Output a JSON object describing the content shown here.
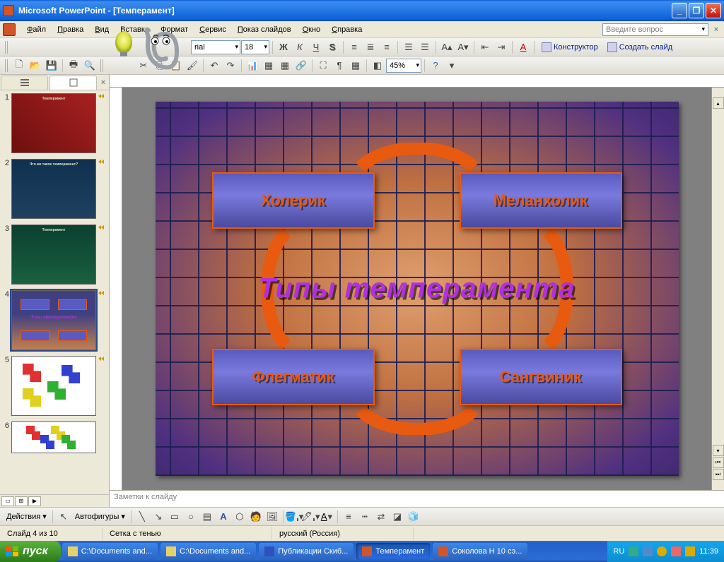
{
  "window": {
    "title": "Microsoft PowerPoint - [Темперамент]"
  },
  "menu": {
    "items": [
      "Файл",
      "Правка",
      "Вид",
      "Вставка",
      "Формат",
      "Сервис",
      "Показ слайдов",
      "Окно",
      "Справка"
    ],
    "help_placeholder": "Введите вопрос"
  },
  "toolbar1": {
    "font": "rial",
    "size": "18",
    "constructor": "Конструктор",
    "newslide": "Создать слайд"
  },
  "toolbar2": {
    "zoom": "45%"
  },
  "slide": {
    "title": "Типы темперамента",
    "box_tl": "Холерик",
    "box_tr": "Меланхолик",
    "box_bl": "Флегматик",
    "box_br": "Сангвиник"
  },
  "thumbs": [
    {
      "n": "1"
    },
    {
      "n": "2"
    },
    {
      "n": "3"
    },
    {
      "n": "4"
    },
    {
      "n": "5"
    },
    {
      "n": "6"
    }
  ],
  "notes": "Заметки к слайду",
  "drawbar": {
    "actions": "Действия",
    "autoshapes": "Автофигуры"
  },
  "status": {
    "slide": "Слайд 4 из 10",
    "template": "Сетка с тенью",
    "lang": "русский (Россия)"
  },
  "taskbar": {
    "start": "пуск",
    "items": [
      "C:\\Documents and...",
      "C:\\Documents and...",
      "Публикации Скиб...",
      "Темперамент",
      "Соколова Н 10 сэ..."
    ],
    "lang": "RU",
    "time": "11:39"
  }
}
